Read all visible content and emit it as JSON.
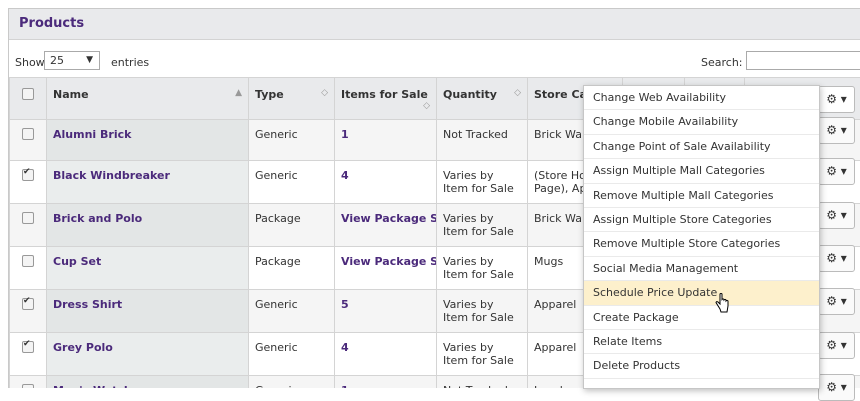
{
  "panel": {
    "title": "Products"
  },
  "toolbar": {
    "show_label": "Show",
    "length_value": "25",
    "entries_label": "entries",
    "search_label": "Search:",
    "search_value": ""
  },
  "columns": {
    "name": "Name",
    "type": "Type",
    "items_for_sale": "Items for Sale",
    "quantity": "Quantity",
    "store_categories": "Store Cat"
  },
  "rows": [
    {
      "checked": false,
      "name": "Alumni Brick",
      "type": "Generic",
      "items": "1",
      "quantity": "Not Tracked",
      "store": "Brick Wall"
    },
    {
      "checked": true,
      "name": "Black Windbreaker",
      "type": "Generic",
      "items": "4",
      "quantity": "Varies by Item for Sale",
      "store": "(Store Hon Page), Ap"
    },
    {
      "checked": false,
      "name": "Brick and Polo",
      "type": "Package",
      "items": "View Package Sets",
      "quantity": "Varies by Item for Sale",
      "store": "Brick Wall"
    },
    {
      "checked": false,
      "name": "Cup Set",
      "type": "Package",
      "items": "View Package Sets",
      "quantity": "Varies by Item for Sale",
      "store": "Mugs"
    },
    {
      "checked": true,
      "name": "Dress Shirt",
      "type": "Generic",
      "items": "5",
      "quantity": "Varies by Item for Sale",
      "store": "Apparel"
    },
    {
      "checked": true,
      "name": "Grey Polo",
      "type": "Generic",
      "items": "4",
      "quantity": "Varies by Item for Sale",
      "store": "Apparel"
    },
    {
      "checked": false,
      "name": "Men's Watch",
      "type": "Generic",
      "items": "1",
      "quantity": "Not Tracked",
      "store": "Jewelry"
    }
  ],
  "actions_menu": {
    "items": [
      "Change Web Availability",
      "Change Mobile Availability",
      "Change Point of Sale Availability",
      "Assign Multiple Mall Categories",
      "Remove Multiple Mall Categories",
      "Assign Multiple Store Categories",
      "Remove Multiple Store Categories",
      "Social Media Management",
      "Schedule Price Update",
      "Create Package",
      "Relate Items",
      "Delete Products"
    ],
    "hovered": "Schedule Price Update"
  },
  "colors": {
    "accent": "#4b2a7b",
    "header_bg": "#e9eaec",
    "hover_bg": "#fdf0cc"
  },
  "icons": {
    "row_action": "gear-icon",
    "caret": "caret-down-icon"
  }
}
